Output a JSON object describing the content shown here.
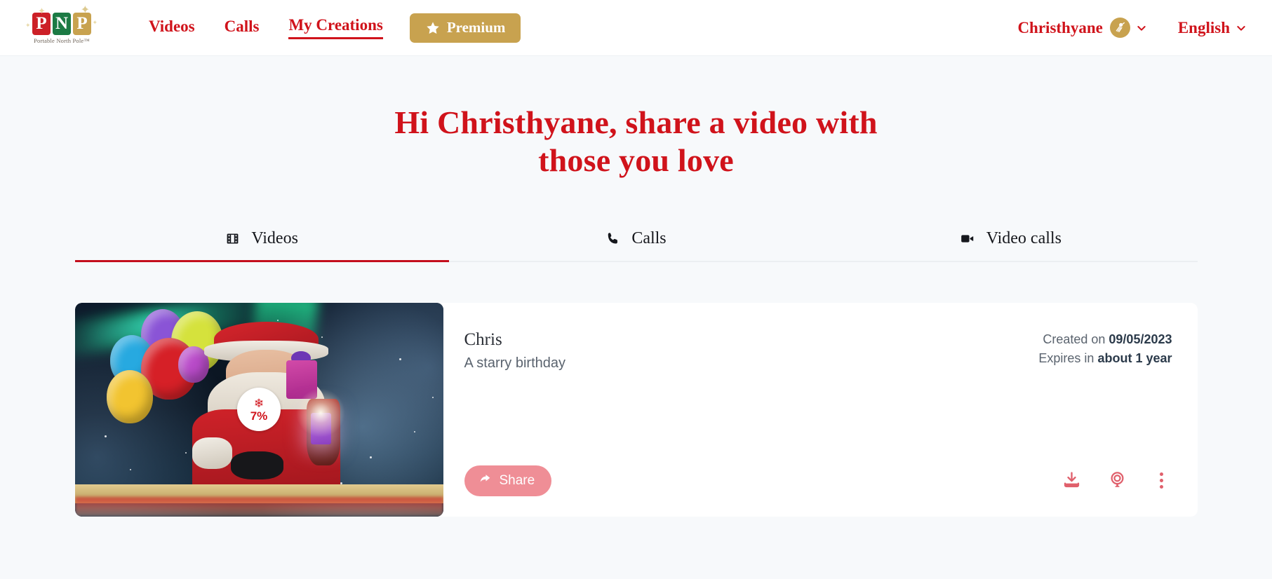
{
  "header": {
    "logo": {
      "tiles": [
        "P",
        "N",
        "P"
      ],
      "caption": "Portable North Pole™",
      "colors": {
        "red": "#cc2027",
        "green": "#1c7a44",
        "gold": "#c8a24f"
      }
    },
    "nav": [
      {
        "label": "Videos",
        "active": false
      },
      {
        "label": "Calls",
        "active": false
      },
      {
        "label": "My Creations",
        "active": true
      }
    ],
    "premium_label": "Premium",
    "premium_icon": "star-icon",
    "user": {
      "name": "Christhyane",
      "avatar_icon": "elf-avatar-icon",
      "chevron_icon": "chevron-down-icon"
    },
    "language": {
      "label": "English",
      "chevron_icon": "chevron-down-icon"
    },
    "accent_red": "#d0131b",
    "accent_gold": "#c8a24f"
  },
  "hero": {
    "line1": "Hi Christhyane, share a video with",
    "line2": "those you love"
  },
  "tabs": [
    {
      "label": "Videos",
      "icon": "film-strip-icon",
      "active": true
    },
    {
      "label": "Calls",
      "icon": "phone-icon",
      "active": false
    },
    {
      "label": "Video calls",
      "icon": "video-camera-icon",
      "active": false
    }
  ],
  "video_card": {
    "title": "Chris",
    "subtitle": "A starry birthday",
    "created_prefix": "Created on ",
    "created_date": "09/05/2023",
    "expires_prefix": "Expires in ",
    "expires_value": "about 1 year",
    "progress": {
      "percent_label": "7%",
      "percent_value": 7,
      "icon": "snowflake-icon"
    },
    "share_label": "Share",
    "share_icon": "share-arrow-icon",
    "actions": [
      {
        "name": "download-icon"
      },
      {
        "name": "record-webcam-icon"
      },
      {
        "name": "more-options-icon"
      }
    ],
    "thumbnail_alt": "Santa in sleigh with balloons at night"
  }
}
